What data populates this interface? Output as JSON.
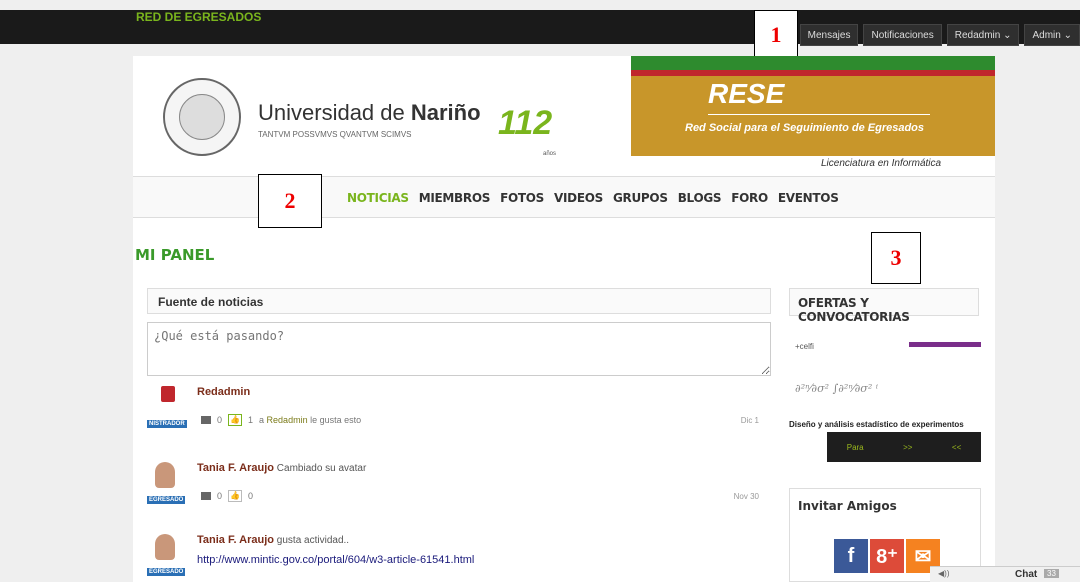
{
  "topbar": {
    "brand": "RED DE EGRESADOS",
    "buttons": [
      "Mensajes",
      "Notificaciones",
      "Redadmin ⌄",
      "Admin ⌄"
    ]
  },
  "annotations": [
    "1",
    "2",
    "3"
  ],
  "header": {
    "university_name_prefix": "Universidad de ",
    "university_name_bold": "Nariño",
    "motto": "TANTVM POSSVMVS QVANTVM SCIMVS",
    "anniversary": "112",
    "anniversary_sub": "años",
    "rese_title": "RESE",
    "rese_subtitle": "Red Social para el Seguimiento de Egresados",
    "program": "Licenciatura en Informática"
  },
  "nav": [
    "NOTICIAS",
    "MIEMBROS",
    "FOTOS",
    "VIDEOS",
    "GRUPOS",
    "BLOGS",
    "FORO",
    "EVENTOS"
  ],
  "main": {
    "panel_title": "MI PANEL",
    "feed_header": "Fuente de noticias",
    "post_placeholder": "¿Qué está pasando?",
    "items": [
      {
        "author": "Redadmin",
        "action": "",
        "badge": "NISTRADOR",
        "comments": "0",
        "likes": "1",
        "likes_text_user": "Redadmin",
        "likes_text_rest": " le gusta esto",
        "date": "Dic 1"
      },
      {
        "author": "Tania F. Araujo",
        "action": " Cambiado su avatar",
        "badge": "EGRESADO",
        "comments": "0",
        "likes": "0",
        "date": "Nov 30"
      },
      {
        "author": "Tania F. Araujo",
        "action": " gusta actividad..",
        "badge": "EGRESADO",
        "link": "http://www.mintic.gov.co/portal/604/w3-article-61541.html"
      }
    ]
  },
  "sidebar": {
    "offers_title": "OFERTAS Y CONVOCATORIAS",
    "ad_logo": "+celfi",
    "ad_formula": "∂²ⁿ⁄∂σ² ∫∂²ⁿ⁄∂σ² ⁱ",
    "ad_caption": "Diseño y análisis estadístico de experimentos",
    "ad_controls": [
      "Para",
      ">>",
      "<<"
    ],
    "invite_title": "Invitar Amigos",
    "social": [
      "f",
      "8⁺",
      "✉"
    ]
  },
  "chat": {
    "volume": "◀))",
    "label": "Chat",
    "count": "33"
  }
}
